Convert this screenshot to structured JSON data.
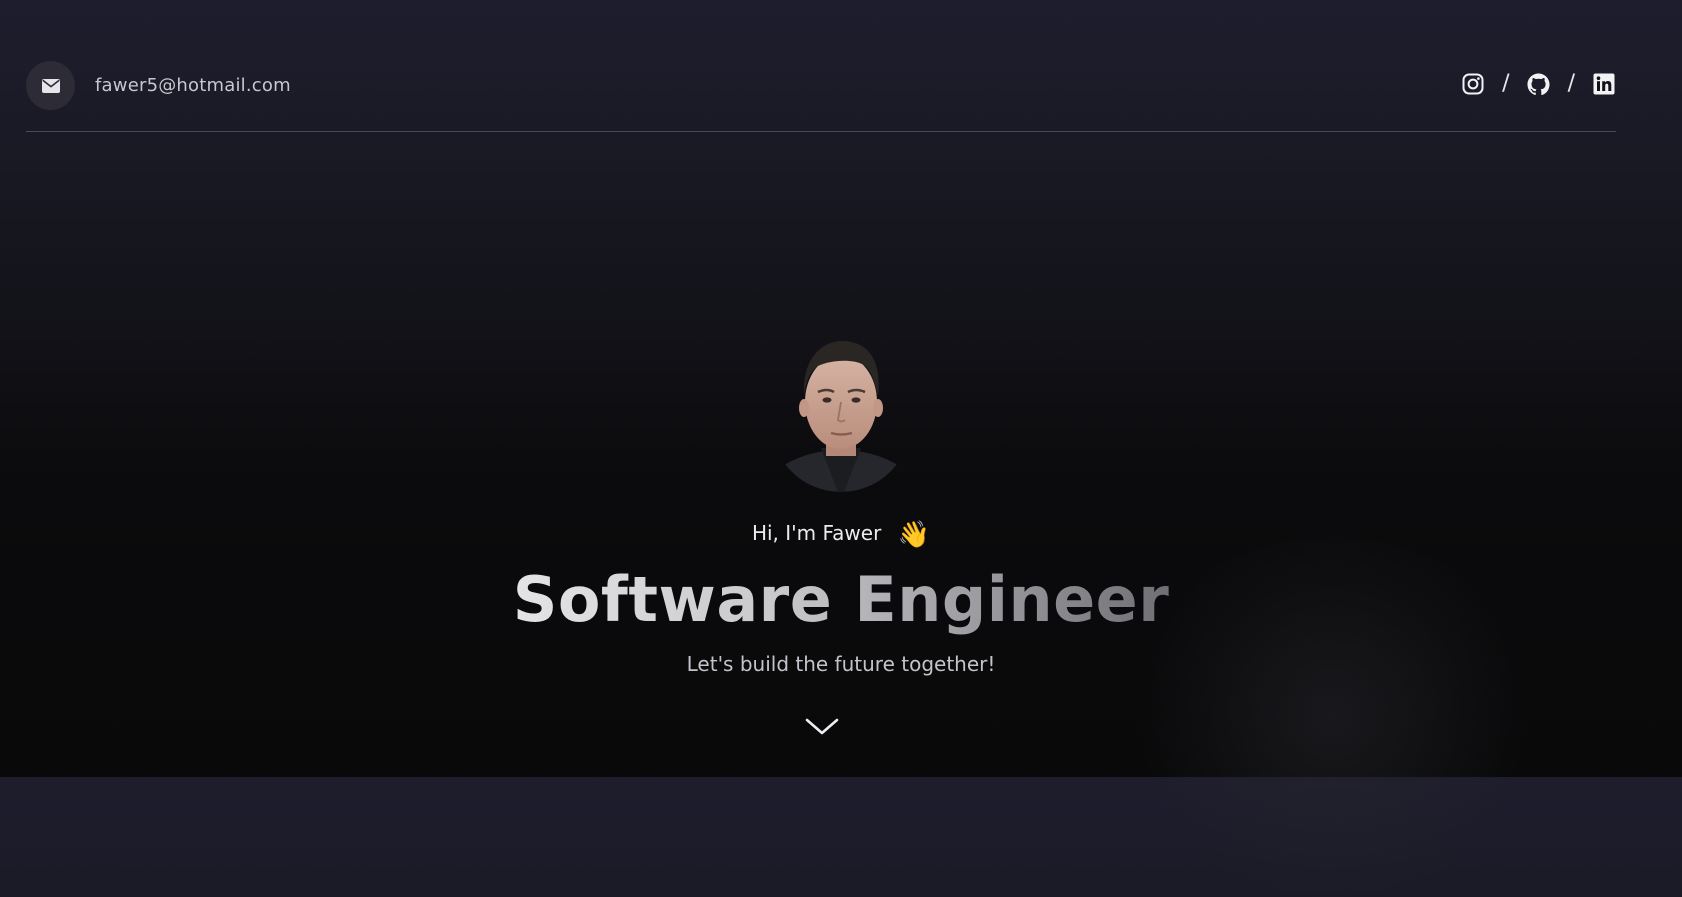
{
  "header": {
    "email": "fawer5@hotmail.com",
    "separator": "/",
    "socials": [
      {
        "name": "instagram-icon"
      },
      {
        "name": "github-icon"
      },
      {
        "name": "linkedin-icon"
      }
    ]
  },
  "hero": {
    "greeting": "Hi, I'm Fawer",
    "wave_emoji": "👋",
    "title": "Software Engineer",
    "subtitle": "Let's build the future together!"
  },
  "colors": {
    "background_top": "#1e1d2d",
    "background_bottom": "#09090a",
    "text_primary": "#e8e8ec",
    "text_muted": "#c3c3cb",
    "mail_circle": "#2c2b36"
  }
}
